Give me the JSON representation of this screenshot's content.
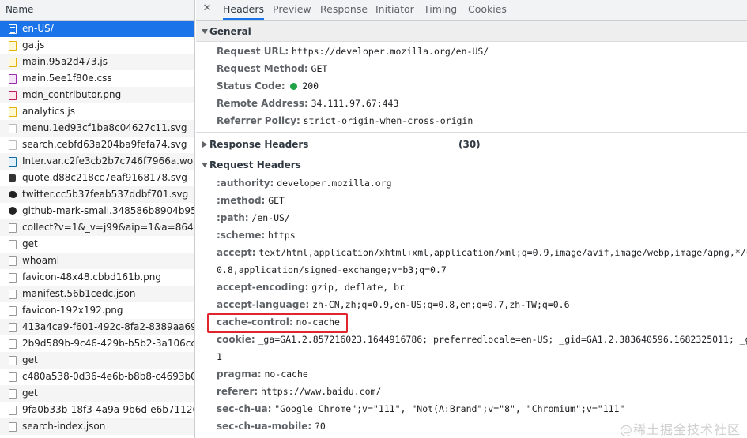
{
  "requests": {
    "header": "Name",
    "items": [
      {
        "name": "en-US/",
        "icon": "doc-icon",
        "selected": true
      },
      {
        "name": "ga.js",
        "icon": "js-icon"
      },
      {
        "name": "main.95a2d473.js",
        "icon": "js-icon"
      },
      {
        "name": "main.5ee1f80e.css",
        "icon": "css-icon"
      },
      {
        "name": "mdn_contributor.png",
        "icon": "png-icon"
      },
      {
        "name": "analytics.js",
        "icon": "js-icon"
      },
      {
        "name": "menu.1ed93cf1ba8c04627c11.svg",
        "icon": "svg-icon"
      },
      {
        "name": "search.cebfd63a204ba9fefa74.svg",
        "icon": "svg-icon"
      },
      {
        "name": "Inter.var.c2fe3cb2b7c746f7966a.woff2",
        "icon": "font-icon"
      },
      {
        "name": "quote.d88c218cc7eaf9168178.svg",
        "icon": "quote-icon"
      },
      {
        "name": "twitter.cc5b37feab537ddbf701.svg",
        "icon": "twitter-icon"
      },
      {
        "name": "github-mark-small.348586b8904b950b...",
        "icon": "github-icon"
      },
      {
        "name": "collect?v=1&_v=j99&aip=1&a=86408...",
        "icon": "blank-icon"
      },
      {
        "name": "get",
        "icon": "blank-icon"
      },
      {
        "name": "whoami",
        "icon": "blank-icon"
      },
      {
        "name": "favicon-48x48.cbbd161b.png",
        "icon": "blank-icon"
      },
      {
        "name": "manifest.56b1cedc.json",
        "icon": "blank-icon"
      },
      {
        "name": "favicon-192x192.png",
        "icon": "blank-icon"
      },
      {
        "name": "413a4ca9-f601-492c-8fa2-8389aa69b5...",
        "icon": "blank-icon"
      },
      {
        "name": "2b9d589b-9c46-429b-b5b2-3a106cc9f...",
        "icon": "blank-icon"
      },
      {
        "name": "get",
        "icon": "blank-icon"
      },
      {
        "name": "c480a538-0d36-4e6b-b8b8-c4693b0a...",
        "icon": "blank-icon"
      },
      {
        "name": "get",
        "icon": "blank-icon"
      },
      {
        "name": "9fa0b33b-18f3-4a9a-9b6d-e6b71126cf...",
        "icon": "blank-icon"
      },
      {
        "name": "search-index.json",
        "icon": "blank-icon"
      }
    ]
  },
  "tabs": {
    "close": "✕",
    "items": [
      "Headers",
      "Preview",
      "Response",
      "Initiator",
      "Timing",
      "Cookies"
    ],
    "active": "Headers"
  },
  "general": {
    "title": "General",
    "rows": [
      {
        "key": "Request URL:",
        "value": "https://developer.mozilla.org/en-US/"
      },
      {
        "key": "Request Method:",
        "value": "GET"
      },
      {
        "key": "Status Code:",
        "value": "200"
      },
      {
        "key": "Remote Address:",
        "value": "34.111.97.67:443"
      },
      {
        "key": "Referrer Policy:",
        "value": "strict-origin-when-cross-origin"
      }
    ]
  },
  "response_headers": {
    "title": "Response Headers",
    "count": "(30)"
  },
  "request_headers": {
    "title": "Request Headers",
    "rows": [
      {
        "key": ":authority:",
        "value": "developer.mozilla.org"
      },
      {
        "key": ":method:",
        "value": "GET"
      },
      {
        "key": ":path:",
        "value": "/en-US/"
      },
      {
        "key": ":scheme:",
        "value": "https"
      },
      {
        "key": "accept:",
        "value": "text/html,application/xhtml+xml,application/xml;q=0.9,image/avif,image/webp,image/apng,*/*;q="
      },
      {
        "key": "",
        "value": "0.8,application/signed-exchange;v=b3;q=0.7"
      },
      {
        "key": "accept-encoding:",
        "value": "gzip, deflate, br"
      },
      {
        "key": "accept-language:",
        "value": "zh-CN,zh;q=0.9,en-US;q=0.8,en;q=0.7,zh-TW;q=0.6"
      },
      {
        "key": "cache-control:",
        "value": "no-cache"
      },
      {
        "key": "cookie:",
        "value": "_ga=GA1.2.857216023.1644916786; preferredlocale=en-US; _gid=GA1.2.383640596.1682325011; _gat="
      },
      {
        "key": "",
        "value": "1"
      },
      {
        "key": "pragma:",
        "value": "no-cache"
      },
      {
        "key": "referer:",
        "value": "https://www.baidu.com/"
      },
      {
        "key": "sec-ch-ua:",
        "value": "\"Google Chrome\";v=\"111\", \"Not(A:Brand\";v=\"8\", \"Chromium\";v=\"111\""
      },
      {
        "key": "sec-ch-ua-mobile:",
        "value": "?0"
      }
    ]
  },
  "watermark": "@稀土掘金技术社区",
  "colors": {
    "accent": "#1a73e8",
    "status_ok": "#1ea446",
    "highlight": "#e0262c"
  }
}
